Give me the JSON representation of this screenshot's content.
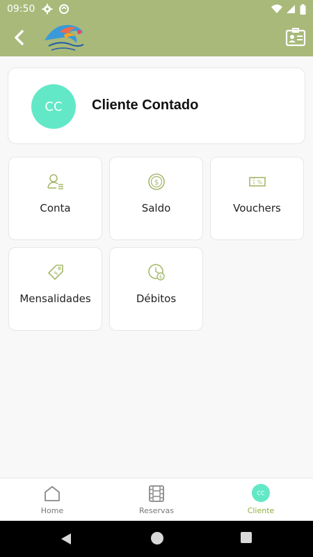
{
  "status_bar": {
    "time": "09:50"
  },
  "profile": {
    "initials": "CC",
    "name": "Cliente Contado"
  },
  "menu_tiles": [
    {
      "label": "Conta",
      "icon": "user-list-icon"
    },
    {
      "label": "Saldo",
      "icon": "dollar-coin-icon"
    },
    {
      "label": "Vouchers",
      "icon": "voucher-percent-icon"
    },
    {
      "label": "Mensalidades",
      "icon": "price-tag-dollar-icon"
    },
    {
      "label": "Débitos",
      "icon": "clock-dollar-icon"
    }
  ],
  "bottom_nav": {
    "items": [
      {
        "label": "Home",
        "icon": "home-icon",
        "active": false
      },
      {
        "label": "Reservas",
        "icon": "film-strip-icon",
        "active": false
      },
      {
        "label": "Cliente",
        "icon": "avatar",
        "initials": "CC",
        "active": true
      }
    ]
  },
  "colors": {
    "header": "#a8b97a",
    "accent": "#8fae3d",
    "avatar": "#62e8c6",
    "icon_green": "#a5b86b"
  }
}
